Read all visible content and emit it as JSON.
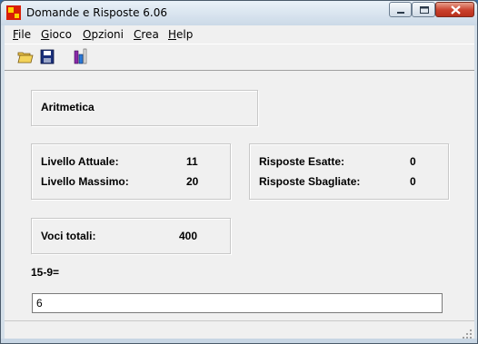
{
  "window": {
    "title": "Domande e Risposte 6.06"
  },
  "menu": {
    "items": [
      "File",
      "Gioco",
      "Opzioni",
      "Crea",
      "Help"
    ]
  },
  "toolbar": {
    "buttons": [
      "open-folder-icon",
      "save-disk-icon",
      "stats-icon"
    ]
  },
  "topic": {
    "name": "Aritmetica"
  },
  "levels": {
    "current_label": "Livello Attuale:",
    "current_value": "11",
    "max_label": "Livello Massimo:",
    "max_value": "20"
  },
  "answers": {
    "correct_label": "Risposte Esatte:",
    "correct_value": "0",
    "wrong_label": "Risposte Sbagliate:",
    "wrong_value": "0"
  },
  "entries": {
    "label": "Voci totali:",
    "value": "400"
  },
  "question": {
    "text": "15-9=",
    "answer_value": "6"
  },
  "colors": {
    "close_button": "#c9402c",
    "title_gradient_top": "#e9f1f8",
    "client_bg": "#f0f0f0"
  }
}
